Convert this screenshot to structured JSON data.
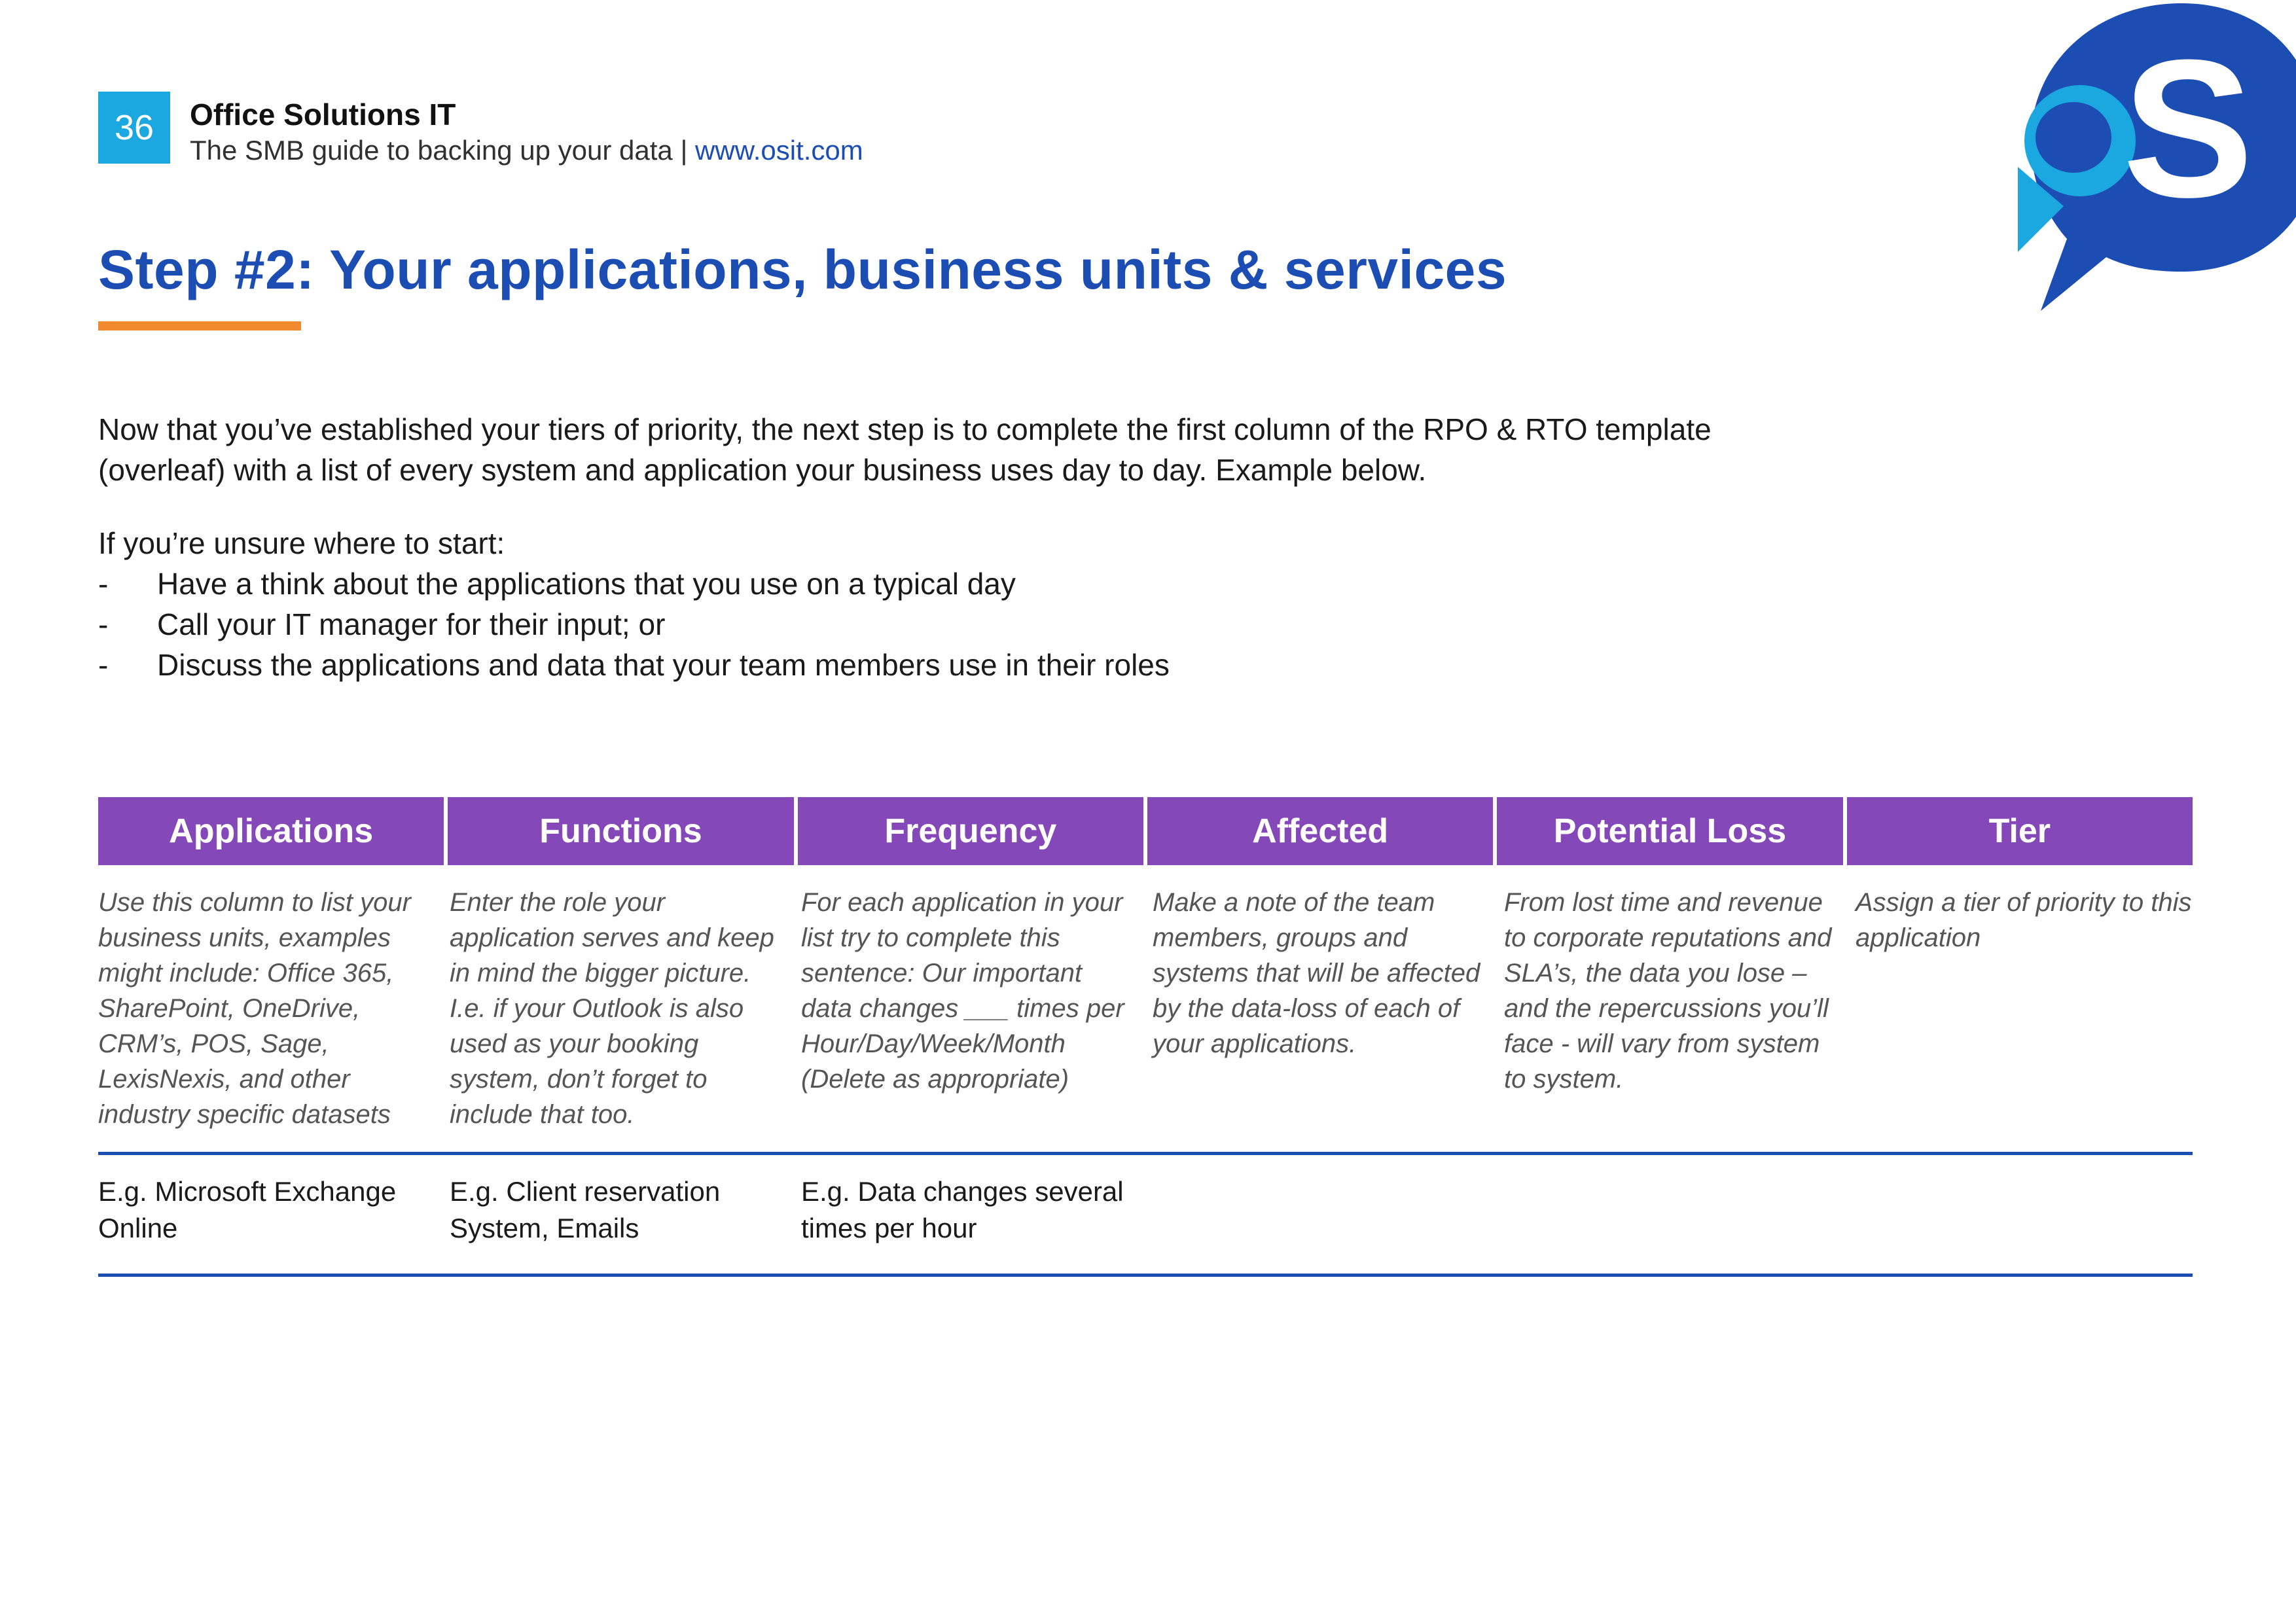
{
  "header": {
    "page_number": "36",
    "title": "Office Solutions IT",
    "subtitle_prefix": "The SMB guide to backing up your data | ",
    "url": "www.osit.com"
  },
  "title": "Step #2: Your applications, business units & services",
  "body": {
    "p1": "Now that you’ve established your tiers of priority, the next step is to complete the first column of the RPO & RTO template (overleaf) with a list of every system and application your business uses day to day. Example below.",
    "p2": "If you’re unsure where to start:",
    "bullets": [
      "Have a think about the applications that you use on a typical day",
      "Call your IT manager for their input; or",
      "Discuss the applications and data that your team members use in their roles"
    ]
  },
  "table": {
    "headers": [
      "Applications",
      "Functions",
      "Frequency",
      "Affected",
      "Potential Loss",
      "Tier"
    ],
    "descriptions": [
      "Use this column to list your business units, examples might include: Office 365, SharePoint, OneDrive, CRM’s, POS, Sage, LexisNexis, and other industry specific datasets",
      "Enter the role your application serves and keep in mind the bigger picture. I.e. if your Outlook is also used as your booking system, don’t forget to include that too.",
      "For each application in your list try to complete this sentence:\nOur important data changes ___ times per Hour/Day/Week/Month (Delete as appropriate)",
      "Make a note of the team members, groups and systems that will be affected by the data-loss of each of your applications.",
      "From lost time and revenue to corporate reputations and SLA’s, the data you lose – and the repercussions you’ll face - will vary from system to system.",
      "Assign a tier of priority to this application"
    ],
    "example_row": [
      "E.g. Microsoft Exchange Online",
      "E.g. Client reservation System, Emails",
      "E.g. Data changes several times per hour",
      "",
      "",
      ""
    ]
  }
}
